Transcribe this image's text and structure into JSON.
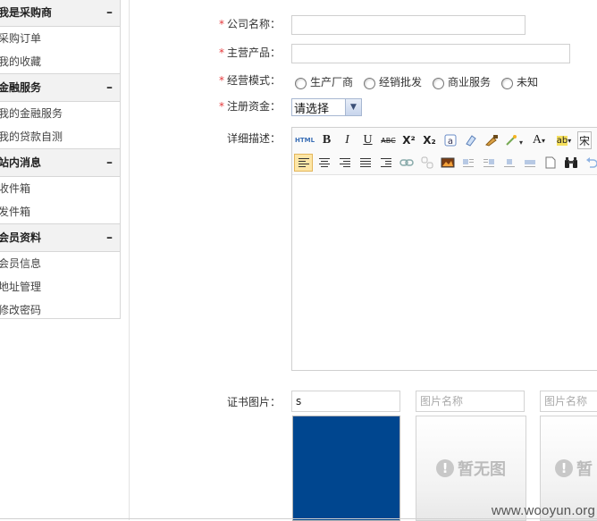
{
  "sidebar": {
    "sections": [
      {
        "title": "我是采购商",
        "toggle": "–",
        "items": [
          "采购订单",
          "我的收藏"
        ]
      },
      {
        "title": "金融服务",
        "toggle": "–",
        "items": [
          "我的金融服务",
          "我的贷款自测"
        ]
      },
      {
        "title": "站内消息",
        "toggle": "–",
        "items": [
          "收件箱",
          "发件箱"
        ]
      },
      {
        "title": "会员资料",
        "toggle": "–",
        "items": [
          "会员信息",
          "地址管理",
          "修改密码"
        ]
      }
    ]
  },
  "form": {
    "required_mark": "*",
    "company_name_label": "公司名称：",
    "company_name_value": "",
    "main_product_label": "主营产品：",
    "main_product_value": "",
    "business_mode_label": "经营模式：",
    "business_modes": [
      "生产厂商",
      "经销批发",
      "商业服务",
      "未知"
    ],
    "capital_label": "注册资金：",
    "capital_selected": "请选择",
    "capital_arrow": "▼",
    "description_label": "详细描述：",
    "certificate_label": "证书图片："
  },
  "editor": {
    "html_btn": "HTML",
    "bold": "B",
    "italic": "I",
    "underline": "U",
    "strike": "ABC",
    "superscript": "X²",
    "subscript": "X₂",
    "font_color": "A",
    "font_dropdown": "▾",
    "highlight": "ab",
    "font_family_partial": "宋"
  },
  "certificates": {
    "image1_name": "s",
    "name_placeholder": "图片名称",
    "no_image_text": "暂无图",
    "no_image_text_partial": "暂"
  },
  "watermark": "www.wooyun.org"
}
